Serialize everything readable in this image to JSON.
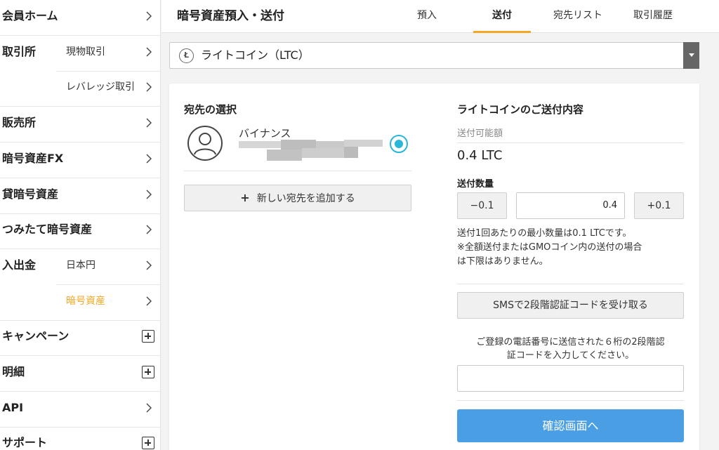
{
  "sidebar": {
    "items": [
      {
        "main": "会員ホーム",
        "sub": "",
        "marker": "chevron"
      },
      {
        "main": "取引所",
        "sub": "現物取引",
        "marker": "chevron"
      },
      {
        "main": "",
        "sub": "レバレッジ取引",
        "marker": "chevron"
      },
      {
        "main": "販売所",
        "sub": "",
        "marker": "chevron"
      },
      {
        "main": "暗号資産FX",
        "sub": "",
        "marker": "chevron"
      },
      {
        "main": "貸暗号資産",
        "sub": "",
        "marker": "chevron"
      },
      {
        "main": "つみたて暗号資産",
        "sub": "",
        "marker": "chevron"
      },
      {
        "main": "入出金",
        "sub": "日本円",
        "marker": "chevron"
      },
      {
        "main": "",
        "sub": "暗号資産",
        "marker": "chevron",
        "active": true
      },
      {
        "main": "キャンペーン",
        "sub": "",
        "marker": "plus"
      },
      {
        "main": "明細",
        "sub": "",
        "marker": "plus"
      },
      {
        "main": "API",
        "sub": "",
        "marker": "chevron"
      },
      {
        "main": "サポート",
        "sub": "",
        "marker": "plus"
      }
    ]
  },
  "header": {
    "title": "暗号資産預入・送付",
    "tabs": [
      "預入",
      "送付",
      "宛先リスト",
      "取引履歴"
    ],
    "active_tab": "送付"
  },
  "currency_select": {
    "icon": "litecoin-icon",
    "value": "ライトコイン（LTC）"
  },
  "destination": {
    "title": "宛先の選択",
    "name": "バイナンス",
    "add_button": "新しい宛先を追加する"
  },
  "send": {
    "title": "ライトコインのご送付内容",
    "available_label": "送付可能額",
    "available_value": "0.4 LTC",
    "quantity_label": "送付数量",
    "minus_label": "−0.1",
    "quantity_value": "0.4",
    "plus_label": "+0.1",
    "note_line1": "送付1回あたりの最小数量は0.1 LTCです。",
    "note_line2": "※全額送付またはGMOコイン内の送付の場合",
    "note_line3": "は下限はありません。",
    "sms_button": "SMSで2段階認証コードを受け取る",
    "code_note_line1": "ご登録の電話番号に送信された６桁の2段階認",
    "code_note_line2": "証コードを入力してください。",
    "code_value": "",
    "confirm_button": "確認画面へ"
  },
  "colors": {
    "accent": "#f5a623",
    "radio": "#29b6d8",
    "primary_button": "#4a9ee3"
  }
}
